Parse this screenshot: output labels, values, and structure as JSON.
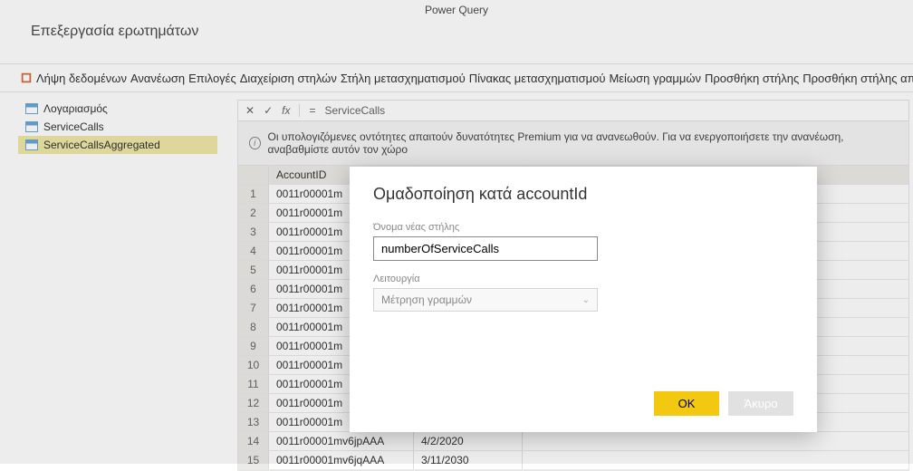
{
  "app_title": "Power Query",
  "section_title": "Επεξεργασία ερωτημάτων",
  "toolbar": {
    "get_data": "Λήψη δεδομένων",
    "refresh": "Ανανέωση",
    "options": "Επιλογές",
    "manage_columns": "Διαχείριση στηλών",
    "transform_column": "Στήλη μετασχηματισμού",
    "transform_table": "Πίνακας μετασχηματισμού",
    "reduce_rows": "Μείωση γραμμών",
    "add_column": "Προσθήκη στήλης",
    "add_column_from": "Προσθήκη στήλης από"
  },
  "queries": {
    "items": [
      {
        "label": "Λογαριασμός"
      },
      {
        "label": "ServiceCalls"
      },
      {
        "label": "ServiceCallsAggregated"
      }
    ]
  },
  "formula_bar": {
    "x": "✕",
    "check": "✓",
    "fx": "fx",
    "eq": "=",
    "value": "ServiceCalls"
  },
  "warning": {
    "text": "Οι υπολογιζόμενες οντότητες απαιτούν δυνατότητες Premium για να ανανεωθούν. Για να ενεργοποιήσετε την ανανέωση, αναβαθμίστε αυτόν τον χώρο"
  },
  "grid": {
    "headers": {
      "col_a": "AccountID",
      "col_b": ""
    },
    "row_count": 15,
    "acct_prefix": "0011r00001m",
    "samples": {
      "14": {
        "a": "0011r00001mv6jpAAA",
        "b": "4/2/2020"
      },
      "15": {
        "a": "0011r00001mv6jqAAA",
        "b": "3/11/2030"
      }
    }
  },
  "dialog": {
    "title": "Ομαδοποίηση κατά accountId",
    "field_new_col": "Όνομα νέας στήλης",
    "new_col_value": "numberOfServiceCalls",
    "field_operation": "Λειτουργία",
    "operation_value": "Μέτρηση γραμμών",
    "ok": "OK",
    "cancel": "Άκυρο"
  }
}
